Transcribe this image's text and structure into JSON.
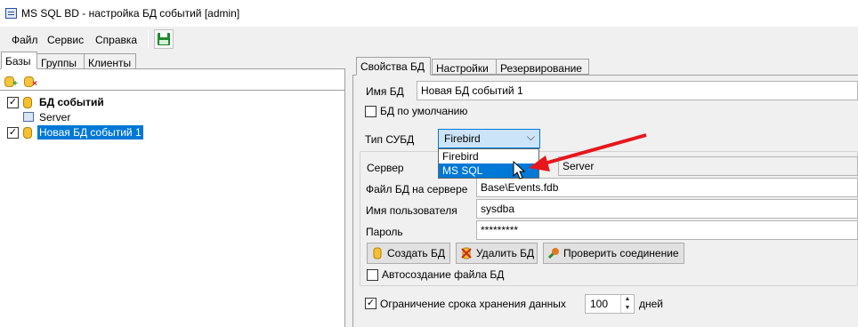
{
  "window": {
    "title": "MS SQL BD - настройка БД событий [admin]"
  },
  "menu": {
    "items": [
      "Файл",
      "Сервис",
      "Справка"
    ]
  },
  "left": {
    "tabs": [
      "Базы",
      "Группы",
      "Клиенты"
    ],
    "tree": [
      {
        "label": "БД событий",
        "checked": true,
        "bold": true
      },
      {
        "label": "Server",
        "child": true
      },
      {
        "label": "Новая БД событий 1",
        "checked": true,
        "selected": true
      }
    ]
  },
  "right": {
    "tabs": [
      "Свойства БД",
      "Настройки",
      "Резервирование"
    ],
    "db_name_label": "Имя БД",
    "db_name_value": "Новая БД событий 1",
    "default_db_label": "БД по умолчанию",
    "dbms_label": "Тип СУБД",
    "dbms_value": "Firebird",
    "dbms_options": [
      "Firebird",
      "MS SQL"
    ],
    "server_label": "Сервер",
    "server_value": "Server",
    "db_file_label": "Файл БД на сервере",
    "db_file_value": "Base\\Events.fdb",
    "user_label": "Имя пользователя",
    "user_value": "sysdba",
    "password_label": "Пароль",
    "password_value": "*********",
    "buttons": {
      "create": "Создать БД",
      "delete": "Удалить БД",
      "check": "Проверить соединение"
    },
    "auto_create_label": "Автосоздание файла БД",
    "retention_label": "Ограничение срока хранения данных",
    "retention_value": "100",
    "retention_unit": "дней"
  },
  "colors": {
    "selection": "#0078d7",
    "arrow": "#e8161b"
  }
}
